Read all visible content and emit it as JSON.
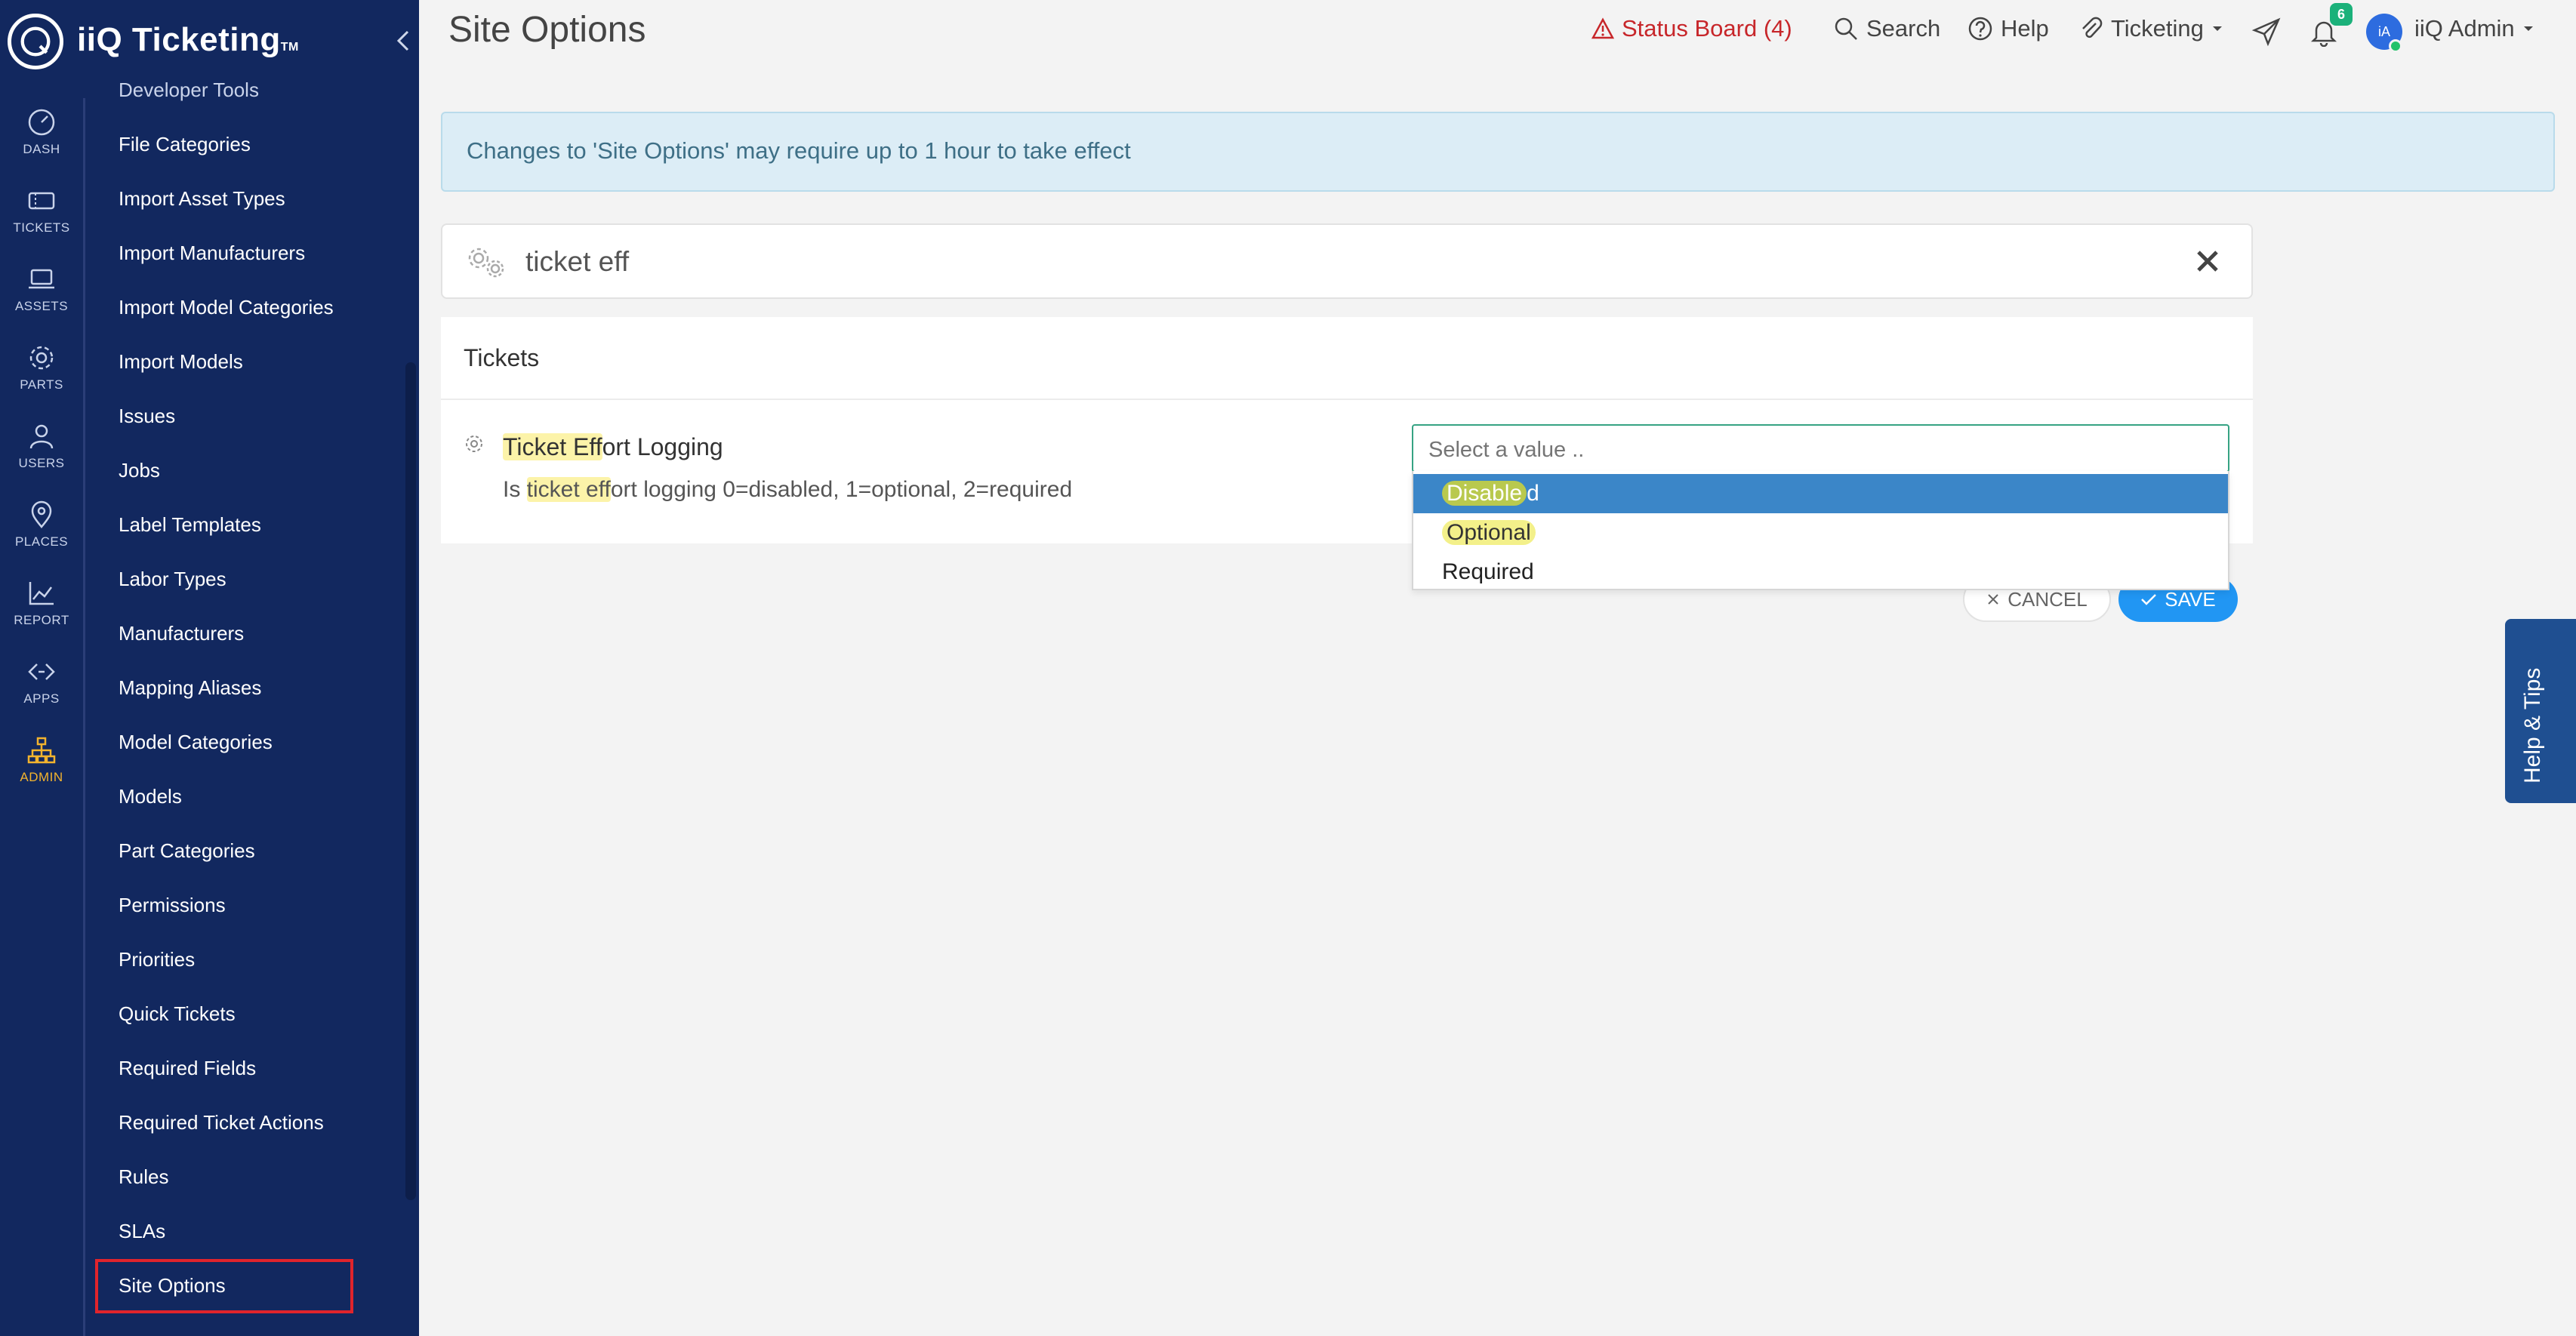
{
  "brand": {
    "name": "iiQ Ticketing",
    "tm": "TM"
  },
  "rail": [
    {
      "label": "DASH",
      "icon": "gauge-icon"
    },
    {
      "label": "TICKETS",
      "icon": "ticket-icon"
    },
    {
      "label": "ASSETS",
      "icon": "laptop-icon"
    },
    {
      "label": "PARTS",
      "icon": "gear-icon"
    },
    {
      "label": "USERS",
      "icon": "user-icon"
    },
    {
      "label": "PLACES",
      "icon": "map-pin-icon"
    },
    {
      "label": "REPORT",
      "icon": "chart-icon"
    },
    {
      "label": "APPS",
      "icon": "apps-icon"
    },
    {
      "label": "ADMIN",
      "icon": "org-chart-icon",
      "active": true
    }
  ],
  "menu": {
    "items": [
      "Developer Tools",
      "File Categories",
      "Import Asset Types",
      "Import Manufacturers",
      "Import Model Categories",
      "Import Models",
      "Issues",
      "Jobs",
      "Label Templates",
      "Labor Types",
      "Manufacturers",
      "Mapping Aliases",
      "Model Categories",
      "Models",
      "Part Categories",
      "Permissions",
      "Priorities",
      "Quick Tickets",
      "Required Fields",
      "Required Ticket Actions",
      "Rules",
      "SLAs",
      "Site Options"
    ],
    "selected": "Site Options"
  },
  "header": {
    "title": "Site Options",
    "status_board": "Status Board (4)",
    "search": "Search",
    "help": "Help",
    "ticketing": "Ticketing",
    "notifications_count": "6",
    "avatar_initials": "iA",
    "user": "iiQ Admin"
  },
  "banner": {
    "text": "Changes to 'Site Options' may require up to 1 hour to take effect"
  },
  "search": {
    "value": "ticket eff"
  },
  "settings": {
    "section": "Tickets",
    "name_hl": "Ticket Eff",
    "name_rest": "ort Logging",
    "desc_prefix": "Is ",
    "desc_hl": "ticket eff",
    "desc_rest": "ort logging 0=disabled, 1=optional, 2=required"
  },
  "select": {
    "placeholder": "Select a value ..",
    "options": [
      {
        "hl": "Disable",
        "rest": "d",
        "selected": true
      },
      {
        "hl": "Optional",
        "rest": ""
      },
      {
        "hl": "",
        "rest": "Required"
      }
    ]
  },
  "buttons": {
    "cancel": "CANCEL",
    "save": "SAVE"
  },
  "help_tab": "Help & Tips",
  "colors": {
    "sidebar": "#12285f",
    "accent": "#2196f3",
    "status": "#c7262a",
    "active_rail": "#f2b32e",
    "highlight": "#fcf3a9"
  }
}
